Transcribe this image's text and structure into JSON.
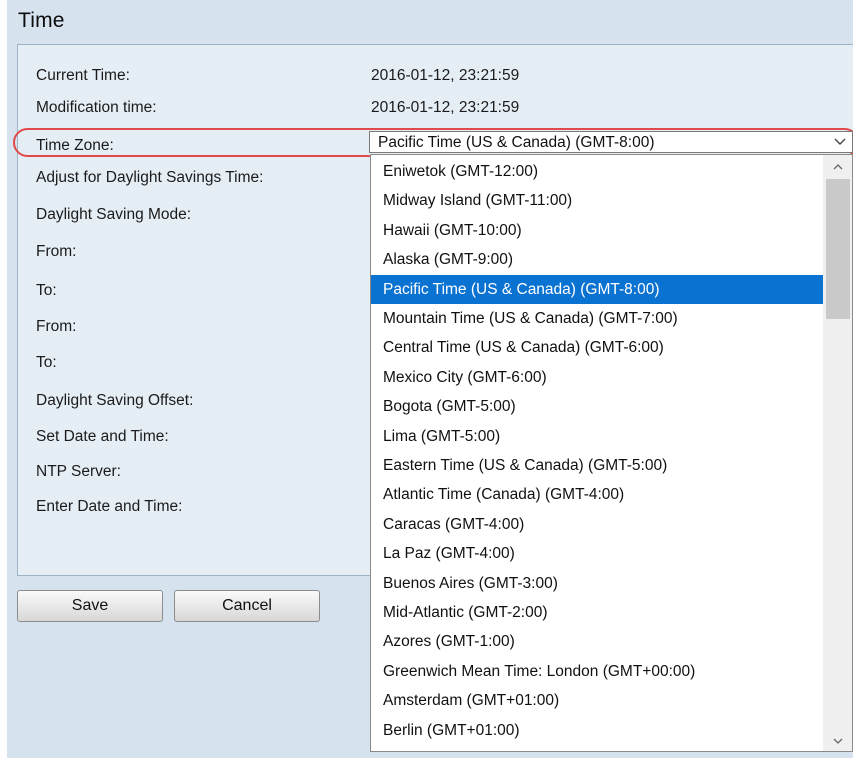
{
  "page": {
    "title": "Time"
  },
  "form": {
    "current_time_label": "Current Time:",
    "current_time_value": "2016-01-12, 23:21:59",
    "modification_time_label": "Modification time:",
    "modification_time_value": "2016-01-12, 23:21:59",
    "time_zone_label": "Time Zone:",
    "adjust_dst_label": "Adjust for Daylight Savings Time:",
    "dst_mode_label": "Daylight Saving Mode:",
    "from_label_1": "From:",
    "to_label_1": "To:",
    "from_label_2": "From:",
    "to_label_2": "To:",
    "dst_offset_label": "Daylight Saving Offset:",
    "set_date_time_label": "Set Date and Time:",
    "ntp_server_label": "NTP Server:",
    "enter_date_time_label": "Enter Date and Time:"
  },
  "timezone_select": {
    "selected": "Pacific Time (US & Canada) (GMT-8:00)",
    "options": [
      "Eniwetok (GMT-12:00)",
      "Midway Island (GMT-11:00)",
      "Hawaii (GMT-10:00)",
      "Alaska (GMT-9:00)",
      "Pacific Time (US & Canada) (GMT-8:00)",
      "Mountain Time (US & Canada) (GMT-7:00)",
      "Central Time (US & Canada) (GMT-6:00)",
      "Mexico City (GMT-6:00)",
      "Bogota (GMT-5:00)",
      "Lima (GMT-5:00)",
      "Eastern Time (US & Canada) (GMT-5:00)",
      "Atlantic Time (Canada) (GMT-4:00)",
      "Caracas (GMT-4:00)",
      "La Paz (GMT-4:00)",
      "Buenos Aires (GMT-3:00)",
      "Mid-Atlantic (GMT-2:00)",
      "Azores (GMT-1:00)",
      "Greenwich Mean Time: London (GMT+00:00)",
      "Amsterdam (GMT+01:00)",
      "Berlin (GMT+01:00)"
    ],
    "chevron_icon": "chevron-down-icon",
    "scroll_up_icon": "chevron-up-icon",
    "scroll_down_icon": "chevron-down-icon"
  },
  "buttons": {
    "save": "Save",
    "cancel": "Cancel"
  },
  "colors": {
    "page_bg": "#d6e3ef",
    "panel_bg": "#e5edf5",
    "highlight": "#e14a4a",
    "selected_option_bg": "#0a72d1"
  }
}
